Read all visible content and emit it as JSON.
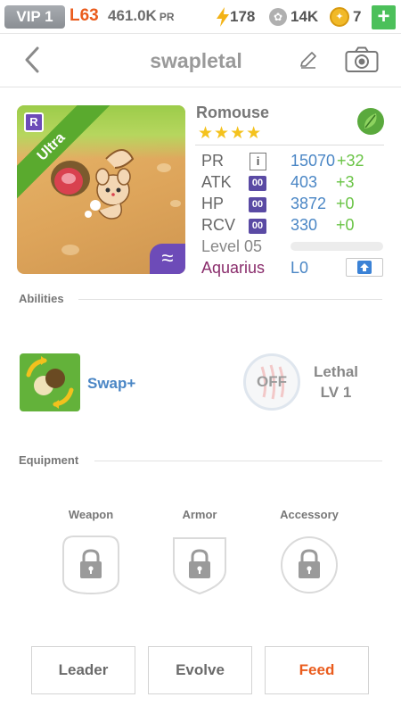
{
  "top_bar": {
    "vip": "VIP 1",
    "player_level": "L63",
    "power_rating": "461.0K",
    "power_rating_unit": "PR",
    "energy": "178",
    "paws": "14K",
    "coins": "7",
    "add_label": "+"
  },
  "header": {
    "title": "swapletal"
  },
  "creature": {
    "name": "Romouse",
    "stars": "★★★★",
    "rarity_ribbon": "Ultra",
    "rarity_badge": "R",
    "element_icon": "leaf-icon",
    "type_tag": "≈",
    "stats": [
      {
        "label": "PR",
        "value": "15070",
        "bonus": "+32"
      },
      {
        "label": "ATK",
        "tag": "00",
        "value": "403",
        "bonus": "+3"
      },
      {
        "label": "HP",
        "tag": "00",
        "value": "3872",
        "bonus": "+0"
      },
      {
        "label": "RCV",
        "tag": "00",
        "value": "330",
        "bonus": "+0"
      }
    ],
    "level": "Level 05",
    "exp_fraction": 0,
    "sign": "Aquarius",
    "sign_level": "L0"
  },
  "abilities": {
    "section_title": "Abilities",
    "active_name": "Swap+",
    "off_label": "OFF",
    "passive_name": "Lethal",
    "passive_level": "LV 1"
  },
  "equipment": {
    "section_title": "Equipment",
    "slots": [
      {
        "label": "Weapon"
      },
      {
        "label": "Armor"
      },
      {
        "label": "Accessory"
      }
    ]
  },
  "actions": {
    "leader": "Leader",
    "evolve": "Evolve",
    "feed": "Feed"
  },
  "colors": {
    "accent_orange": "#ea5c1d",
    "stat_blue": "#4a86c5",
    "bonus_green": "#6ac446",
    "sign_purple": "#8a2d6c",
    "ribbon_green": "#5aaa2e"
  }
}
